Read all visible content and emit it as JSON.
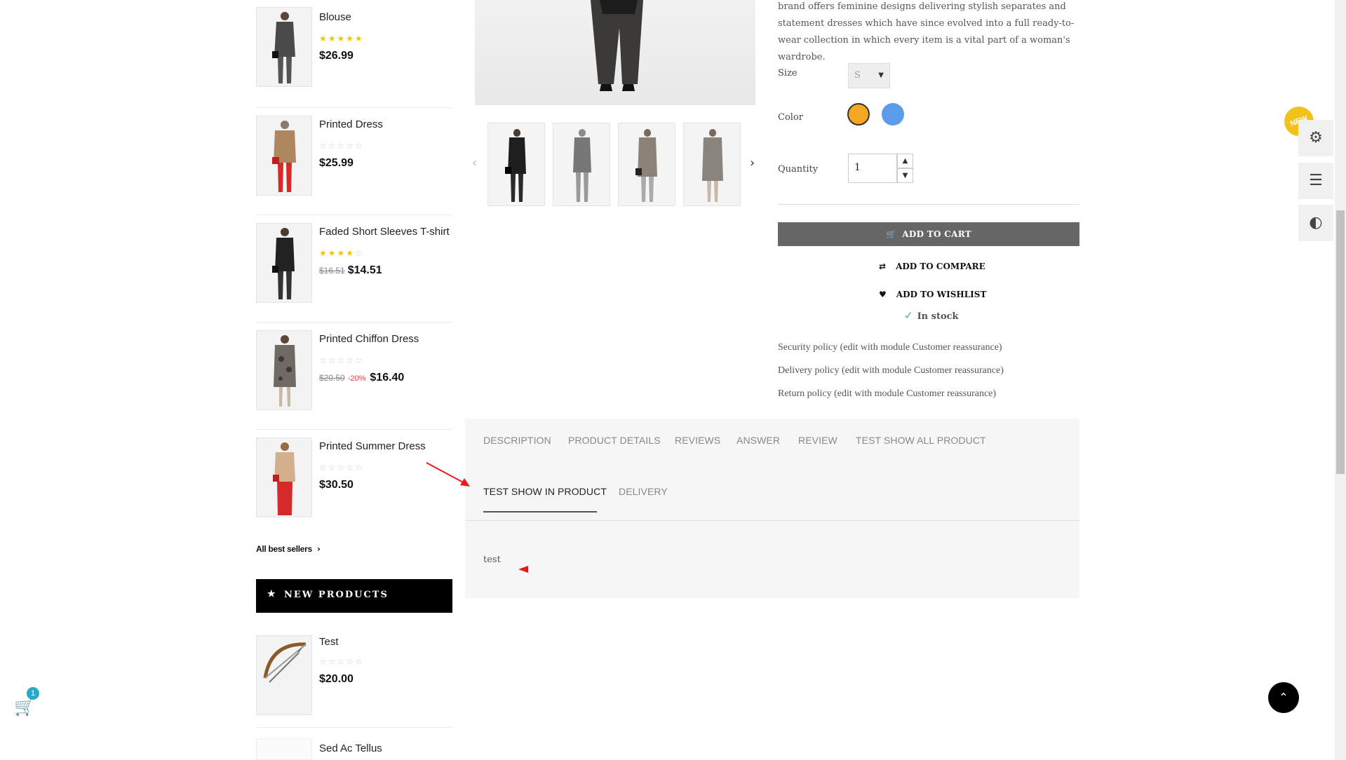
{
  "sidebar": {
    "bestsellers": [
      {
        "name": "Blouse",
        "rating": 5,
        "price": "$26.99"
      },
      {
        "name": "Printed Dress",
        "rating": 0,
        "price": "$25.99"
      },
      {
        "name": "Faded Short Sleeves T-shirt",
        "rating": 4,
        "old_price": "$16.51",
        "price": "$14.51"
      },
      {
        "name": "Printed Chiffon Dress",
        "rating": 0,
        "old_price": "$20.50",
        "discount": "-20%",
        "price": "$16.40"
      },
      {
        "name": "Printed Summer Dress",
        "rating": 0,
        "price": "$30.50"
      }
    ],
    "all_best_sellers": "All best sellers",
    "new_products_title": "NEW PRODUCTS",
    "new_products": [
      {
        "name": "Test",
        "rating": 0,
        "price": "$20.00"
      },
      {
        "name": "Sed Ac Tellus"
      }
    ]
  },
  "product": {
    "description": "brand offers feminine designs delivering stylish separates and statement dresses which have since evolved into a full ready-to-wear collection in which every item is a vital part of a woman's wardrobe.",
    "size_label": "Size",
    "size_value": "S",
    "color_label": "Color",
    "colors": [
      "#f5a623",
      "#5b9be8"
    ],
    "quantity_label": "Quantity",
    "quantity_value": "1",
    "add_to_cart": "ADD TO CART",
    "add_to_compare": "ADD TO COMPARE",
    "add_to_wishlist": "ADD TO WISHLIST",
    "stock": "In stock",
    "policies": [
      "Security policy (edit with module Customer reassurance)",
      "Delivery policy (edit with module Customer reassurance)",
      "Return policy (edit with module Customer reassurance)"
    ]
  },
  "tabs": {
    "row1": [
      "DESCRIPTION",
      "PRODUCT DETAILS",
      "REVIEWS",
      "ANSWER",
      "REVIEW",
      "TEST SHOW ALL PRODUCT"
    ],
    "row2": [
      "TEST SHOW IN PRODUCT",
      "DELIVERY"
    ],
    "active": "TEST SHOW IN PRODUCT",
    "content": "test"
  },
  "widgets": {
    "new_badge": "NEW",
    "cart_count": "1"
  },
  "icons": [
    "cart-icon",
    "star-icon",
    "chevron-right-icon",
    "chevron-left-icon",
    "compare-icon",
    "heart-icon",
    "check-icon",
    "gear-icon",
    "sliders-icon",
    "contrast-icon",
    "double-chevron-up-icon"
  ]
}
